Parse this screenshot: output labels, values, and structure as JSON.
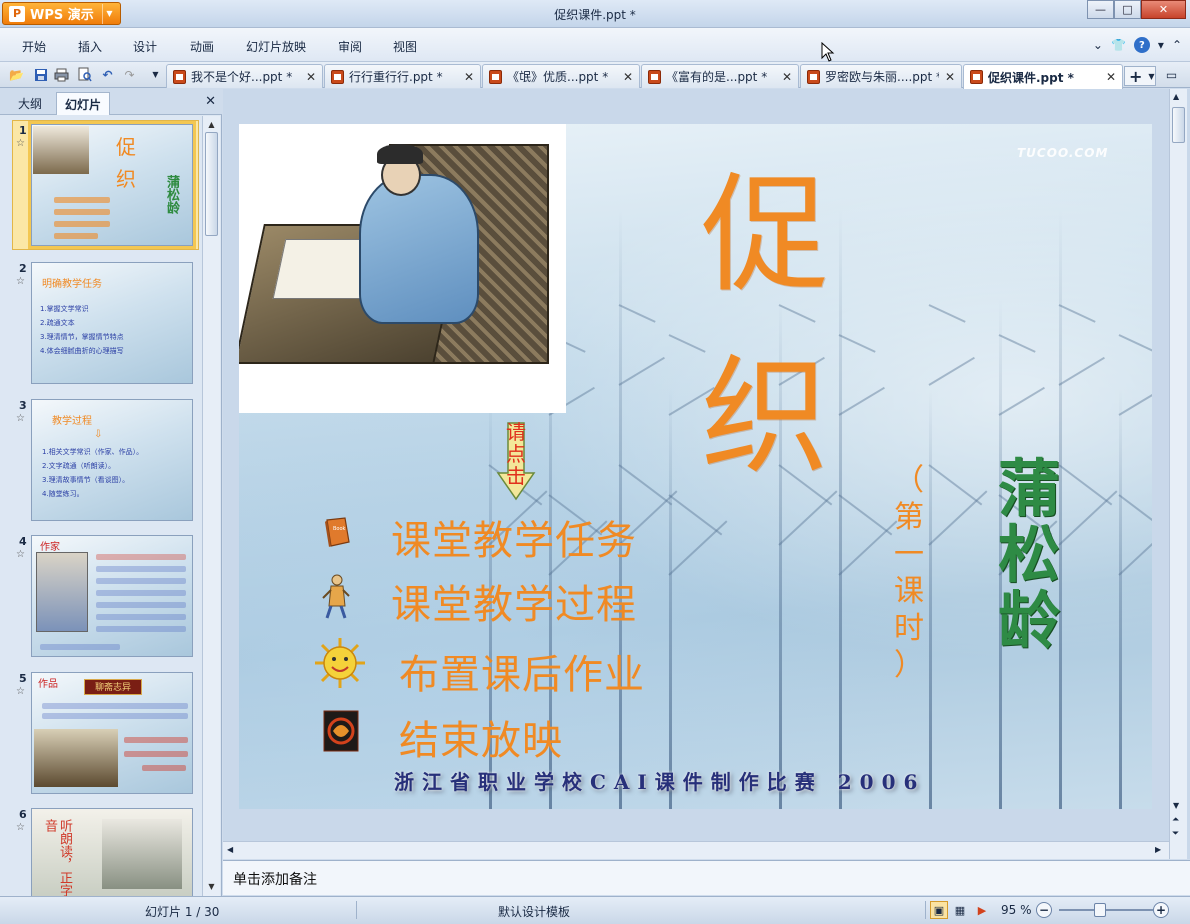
{
  "app": {
    "menu_button": "WPS 演示",
    "logo_glyph": "P",
    "title": "促织课件.ppt *"
  },
  "window_controls": {
    "minimize": "—",
    "maximize": "□",
    "close": "✕"
  },
  "menubar": {
    "items": [
      "开始",
      "插入",
      "设计",
      "动画",
      "幻灯片放映",
      "审阅",
      "视图"
    ]
  },
  "tabs": [
    {
      "label": "我不是个好...ppt *",
      "active": false
    },
    {
      "label": "行行重行行.ppt *",
      "active": false
    },
    {
      "label": "《氓》优质...ppt *",
      "active": false
    },
    {
      "label": "《富有的是...ppt *",
      "active": false
    },
    {
      "label": "罗密欧与朱丽....ppt *",
      "active": false
    },
    {
      "label": "促织课件.ppt *",
      "active": true
    }
  ],
  "left_panel": {
    "tabs": [
      "大纲",
      "幻灯片"
    ],
    "active_tab": "幻灯片",
    "thumbnails": [
      {
        "number": "1",
        "selected": true
      },
      {
        "number": "2",
        "title": "明确教学任务"
      },
      {
        "number": "3",
        "title": "教学过程"
      },
      {
        "number": "4",
        "title": "作家"
      },
      {
        "number": "5",
        "title": "作品"
      },
      {
        "number": "6"
      }
    ],
    "thumb_texts": {
      "s1_title_1": "促",
      "s1_title_2": "织",
      "s1_author": "蒲松龄",
      "s2_items": [
        "1.掌握文学常识",
        "2.疏通文本",
        "3.理清情节，掌握情节特点",
        "4.体会细腻曲折的心理描写"
      ],
      "s3_items": [
        "1.相关文学常识（作家、作品）。",
        "2.文字疏通（听朗读）。",
        "3.理清故事情节（看谈图）。",
        "4.随堂练习。"
      ],
      "s5_banner": "聊斋志异",
      "s6_text": "听朗读，正字音"
    }
  },
  "slide": {
    "watermark": "TUCOO.COM",
    "title_char_1": "促",
    "title_char_2": "织",
    "lesson": [
      "（",
      "第",
      "一",
      "课",
      "时",
      "）"
    ],
    "author": [
      "蒲",
      "松",
      "龄"
    ],
    "click_hint": [
      "请",
      "点",
      "击"
    ],
    "menu": [
      {
        "label": "课堂教学任务",
        "icon": "book-icon"
      },
      {
        "label": "课堂教学过程",
        "icon": "running-figure-icon"
      },
      {
        "label": "布置课后作业",
        "icon": "sun-face-icon"
      },
      {
        "label": "结束放映",
        "icon": "end-emblem-icon"
      }
    ],
    "footer": "浙江省职业学校CAI课件制作比赛 2006"
  },
  "notes": {
    "placeholder": "单击添加备注"
  },
  "status": {
    "slide_info": "幻灯片 1 / 30",
    "template": "默认设计模板",
    "zoom": "95 %",
    "zoom_value": 95
  },
  "colors": {
    "title_orange": "#f08a24",
    "author_green": "#2e8b45",
    "wps_orange": "#f07c0a",
    "footer_blue": "#27307a"
  }
}
